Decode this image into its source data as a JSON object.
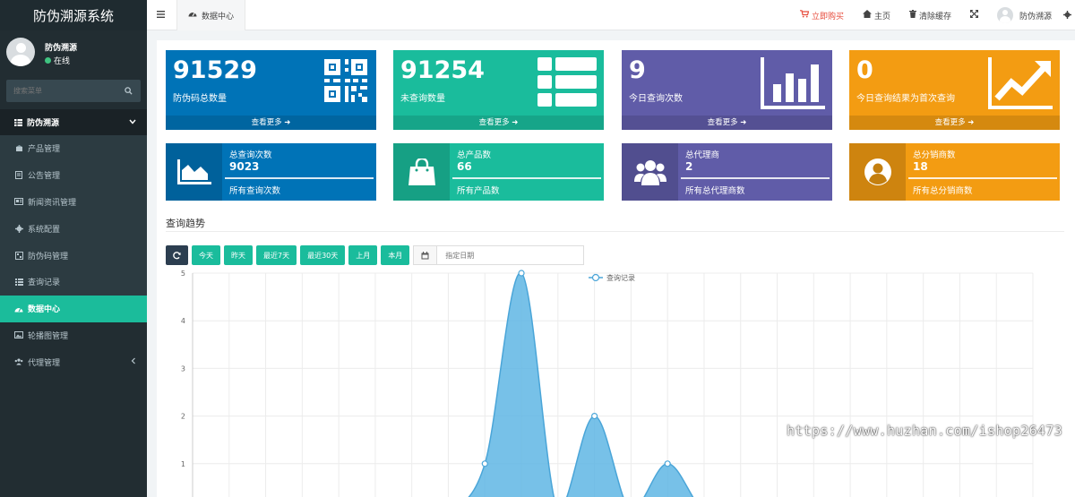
{
  "app": {
    "title": "防伪溯源系统"
  },
  "user": {
    "name": "防伪溯源",
    "status": "在线"
  },
  "sidebar": {
    "search_placeholder": "搜索菜单",
    "header": "防伪溯源",
    "items": [
      {
        "label": "产品管理",
        "icon": "cube-icon"
      },
      {
        "label": "公告管理",
        "icon": "document-icon"
      },
      {
        "label": "新闻资讯管理",
        "icon": "newspaper-icon"
      },
      {
        "label": "系统配置",
        "icon": "gear-icon"
      },
      {
        "label": "防伪码管理",
        "icon": "barcode-icon"
      },
      {
        "label": "查询记录",
        "icon": "list-icon"
      },
      {
        "label": "数据中心",
        "icon": "dashboard-icon"
      },
      {
        "label": "轮播图管理",
        "icon": "image-icon"
      },
      {
        "label": "代理管理",
        "icon": "users-icon"
      }
    ],
    "active": "数据中心"
  },
  "topbar": {
    "tab": "数据中心",
    "buy": "立即购买",
    "home": "主页",
    "clear_cache": "清除缓存",
    "user": "防伪溯源"
  },
  "stats": [
    {
      "value": "91529",
      "label": "防伪码总数量",
      "more": "查看更多",
      "color": "#0073b7",
      "icon": "qrcode-icon"
    },
    {
      "value": "91254",
      "label": "未查询数量",
      "more": "查看更多",
      "color": "#1abc9c",
      "icon": "list-icon"
    },
    {
      "value": "9",
      "label": "今日查询次数",
      "more": "查看更多",
      "color": "#605ca8",
      "icon": "bar-chart-icon"
    },
    {
      "value": "0",
      "label": "今日查询结果为首次查询",
      "more": "查看更多",
      "color": "#f39c12",
      "icon": "line-chart-icon"
    }
  ],
  "mini_stats": [
    {
      "title": "总查询次数",
      "value": "9023",
      "footer": "所有查询次数",
      "icon": "area-chart-icon"
    },
    {
      "title": "总产品数",
      "value": "66",
      "footer": "所有产品数",
      "icon": "shopping-bag-icon"
    },
    {
      "title": "总代理商",
      "value": "2",
      "footer": "所有总代理商数",
      "icon": "users-icon"
    },
    {
      "title": "总分销商数",
      "value": "18",
      "footer": "所有总分销商数",
      "icon": "user-circle-icon"
    }
  ],
  "trend": {
    "title": "查询趋势",
    "buttons": [
      "今天",
      "昨天",
      "最近7天",
      "最近30天",
      "上月",
      "本月"
    ],
    "date_placeholder": "指定日期"
  },
  "chart_data": {
    "type": "area",
    "series": [
      {
        "name": "查询记录",
        "values": [
          0,
          0,
          0,
          0,
          0,
          0,
          0,
          0,
          1,
          5,
          0,
          2,
          0,
          1,
          0,
          0,
          0,
          0,
          0,
          0,
          0,
          0,
          0,
          0
        ]
      }
    ],
    "yticks": [
      "1",
      "2",
      "3",
      "4",
      "5"
    ],
    "ylim": [
      0,
      5
    ],
    "grid": true,
    "legend": "top-center",
    "color": "#5fb6e4"
  },
  "watermark": "https://www.huzhan.com/ishop26473"
}
